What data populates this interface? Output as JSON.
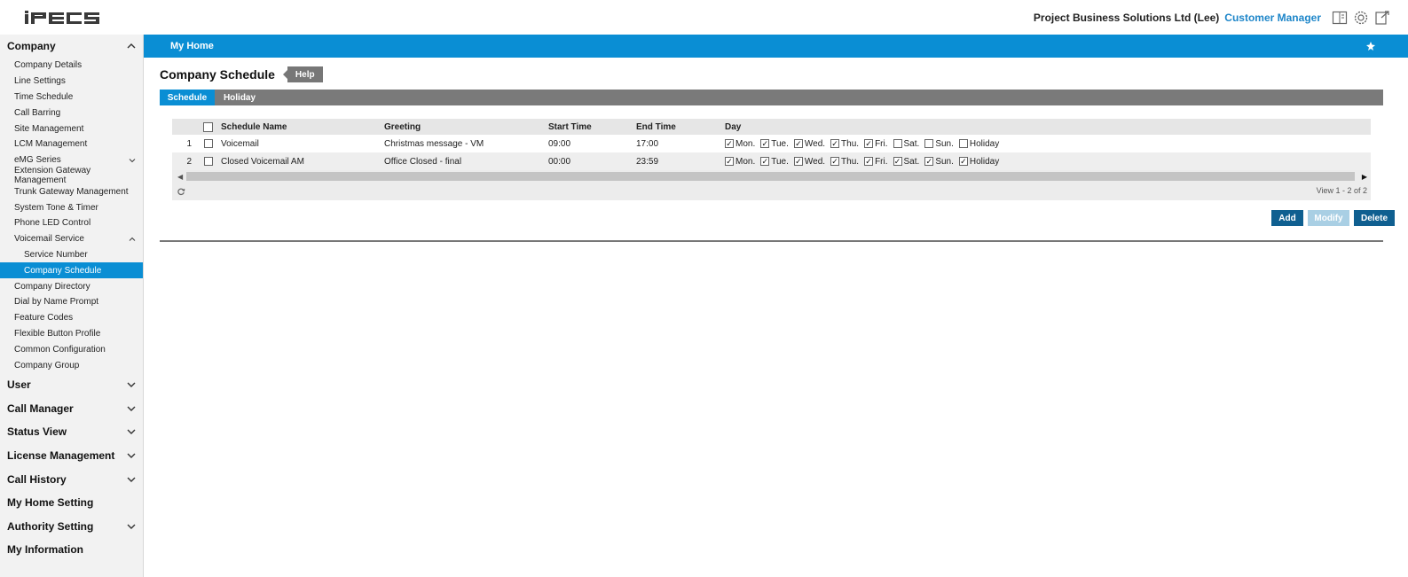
{
  "header": {
    "company": "Project Business Solutions Ltd (Lee)",
    "role": "Customer Manager",
    "icons": [
      "manual-icon",
      "settings-icon",
      "logout-icon"
    ]
  },
  "sidebar": {
    "company": {
      "label": "Company",
      "items": [
        {
          "label": "Company Details"
        },
        {
          "label": "Line Settings"
        },
        {
          "label": "Time Schedule"
        },
        {
          "label": "Call Barring"
        },
        {
          "label": "Site Management"
        },
        {
          "label": "LCM Management"
        },
        {
          "label": "eMG Series"
        },
        {
          "label": "Extension Gateway Management"
        },
        {
          "label": "Trunk Gateway Management"
        },
        {
          "label": "System Tone & Timer"
        },
        {
          "label": "Phone LED Control"
        },
        {
          "label": "Voicemail Service"
        },
        {
          "label": "Service Number"
        },
        {
          "label": "Company Schedule"
        },
        {
          "label": "Company Directory"
        },
        {
          "label": "Dial by Name Prompt"
        },
        {
          "label": "Feature Codes"
        },
        {
          "label": "Flexible Button Profile"
        },
        {
          "label": "Common Configuration"
        },
        {
          "label": "Company Group"
        }
      ]
    },
    "sections": [
      {
        "label": "User"
      },
      {
        "label": "Call Manager"
      },
      {
        "label": "Status View"
      },
      {
        "label": "License Management"
      },
      {
        "label": "Call History"
      },
      {
        "label": "My Home Setting"
      },
      {
        "label": "Authority Setting"
      },
      {
        "label": "My Information"
      }
    ]
  },
  "main": {
    "bar_title": "My Home",
    "page_title": "Company Schedule",
    "help_label": "Help",
    "tabs": [
      {
        "label": "Schedule"
      },
      {
        "label": "Holiday"
      }
    ],
    "columns": {
      "name": "Schedule Name",
      "greeting": "Greeting",
      "start": "Start Time",
      "end": "End Time",
      "day": "Day"
    },
    "day_labels": {
      "mon": "Mon.",
      "tue": "Tue.",
      "wed": "Wed.",
      "thu": "Thu.",
      "fri": "Fri.",
      "sat": "Sat.",
      "sun": "Sun.",
      "holiday": "Holiday"
    },
    "rows": [
      {
        "num": "1",
        "name": "Voicemail",
        "greeting": "Christmas message - VM",
        "start": "09:00",
        "end": "17:00",
        "days": {
          "mon": true,
          "tue": true,
          "wed": true,
          "thu": true,
          "fri": true,
          "sat": false,
          "sun": false,
          "holiday": false
        }
      },
      {
        "num": "2",
        "name": "Closed Voicemail AM",
        "greeting": "Office Closed - final",
        "start": "00:00",
        "end": "23:59",
        "days": {
          "mon": true,
          "tue": true,
          "wed": true,
          "thu": true,
          "fri": true,
          "sat": true,
          "sun": true,
          "holiday": true
        }
      }
    ],
    "view_count": "View 1 - 2 of 2",
    "buttons": {
      "add": "Add",
      "modify": "Modify",
      "delete": "Delete"
    }
  },
  "colors": {
    "accent": "#0a8ed4",
    "button": "#0f5f90",
    "button_disabled": "#a9cfe4",
    "tabbar": "#7a7a7a"
  }
}
